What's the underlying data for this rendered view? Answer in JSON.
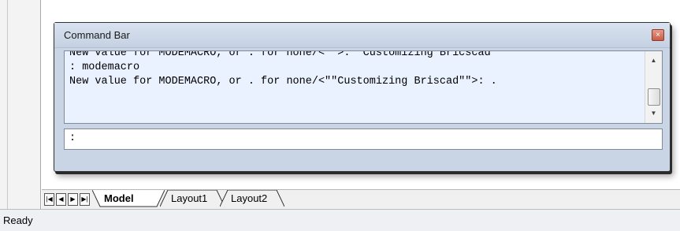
{
  "command_bar": {
    "title": "Command Bar",
    "close_glyph": "×",
    "history_lines": [
      "New value for MODEMACRO, or . for none/<\"\">: \"Customizing Bricscad\"",
      ": modemacro",
      "New value for MODEMACRO, or . for none/<\"\"Customizing Briscad\"\">: ."
    ],
    "prompt": ":",
    "input_value": ""
  },
  "layout_tabs": {
    "nav": [
      "first-tab",
      "prev-tab",
      "next-tab",
      "last-tab"
    ],
    "tabs": [
      "Model",
      "Layout1",
      "Layout2"
    ],
    "active": "Model"
  },
  "status_bar": {
    "text": "Ready"
  }
}
